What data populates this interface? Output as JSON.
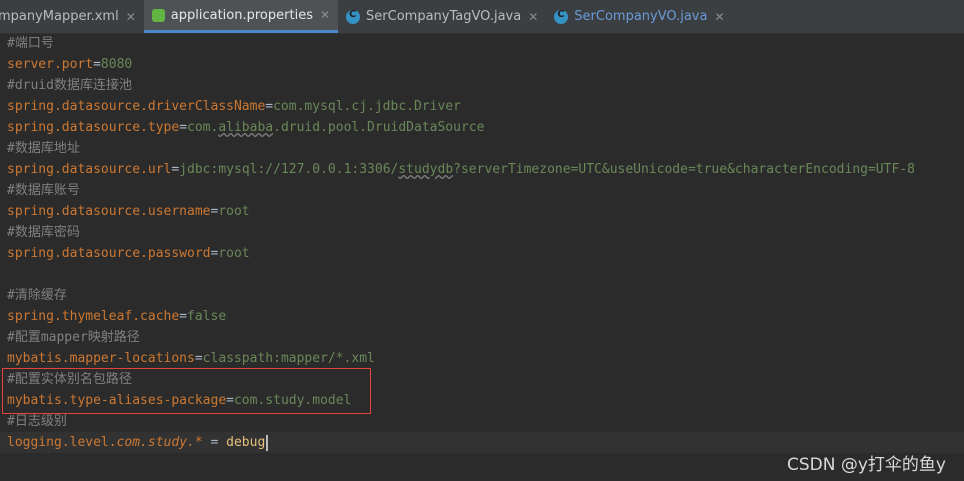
{
  "tabs": [
    {
      "label": "ompanyMapper.xml",
      "icon": "xml-file-icon",
      "active": false
    },
    {
      "label": "application.properties",
      "icon": "properties-file-icon",
      "active": true
    },
    {
      "label": "SerCompanyTagVO.java",
      "icon": "java-class-icon",
      "active": false
    },
    {
      "label": "SerCompanyVO.java",
      "icon": "java-class-icon",
      "active": false
    }
  ],
  "close_glyph": "✕",
  "code": {
    "l1": "#端口号",
    "l2_key": "server.port",
    "l2_val": "8080",
    "l3": "#druid数据库连接池",
    "l4_key": "spring.datasource.driverClassName",
    "l4_val": "com.mysql.cj.jdbc.Driver",
    "l5_key": "spring.datasource.type",
    "l5_val_a": "com.",
    "l5_val_b": "alibaba",
    "l5_val_c": ".druid.pool.DruidDataSource",
    "l6": "#数据库地址",
    "l7_key": "spring.datasource.url",
    "l7_val_a": "jdbc:mysql://127.0.0.1:3306/",
    "l7_val_b": "studydb",
    "l7_val_c": "?serverTimezone=UTC&useUnicode=true&characterEncoding=UTF-8",
    "l8": "#数据库账号",
    "l9_key": "spring.datasource.username",
    "l9_val": "root",
    "l10": "#数据库密码",
    "l11_key": "spring.datasource.password",
    "l11_val": "root",
    "l12": "",
    "l13": "#清除缓存",
    "l14_key": "spring.thymeleaf.cache",
    "l14_val": "false",
    "l15": "#配置mapper映射路径",
    "l16_key": "mybatis.mapper-locations",
    "l16_val": "classpath:mapper/*.xml",
    "l17": "#配置实体别名包路径",
    "l18_key": "mybatis.type-aliases-package",
    "l18_val": "com.study.model",
    "l19": "#日志级别",
    "l20_key_a": "logging.level.",
    "l20_key_b": "com.study.*",
    "l20_eq": " = ",
    "l20_val": "debug"
  },
  "equals": "=",
  "watermark": "CSDN @y打伞的鱼y",
  "colors": {
    "comment": "#808080",
    "key": "#cc7832",
    "value": "#6a8759",
    "highlight_box": "#e0443e",
    "active_tab_underline": "#4a88c7"
  }
}
